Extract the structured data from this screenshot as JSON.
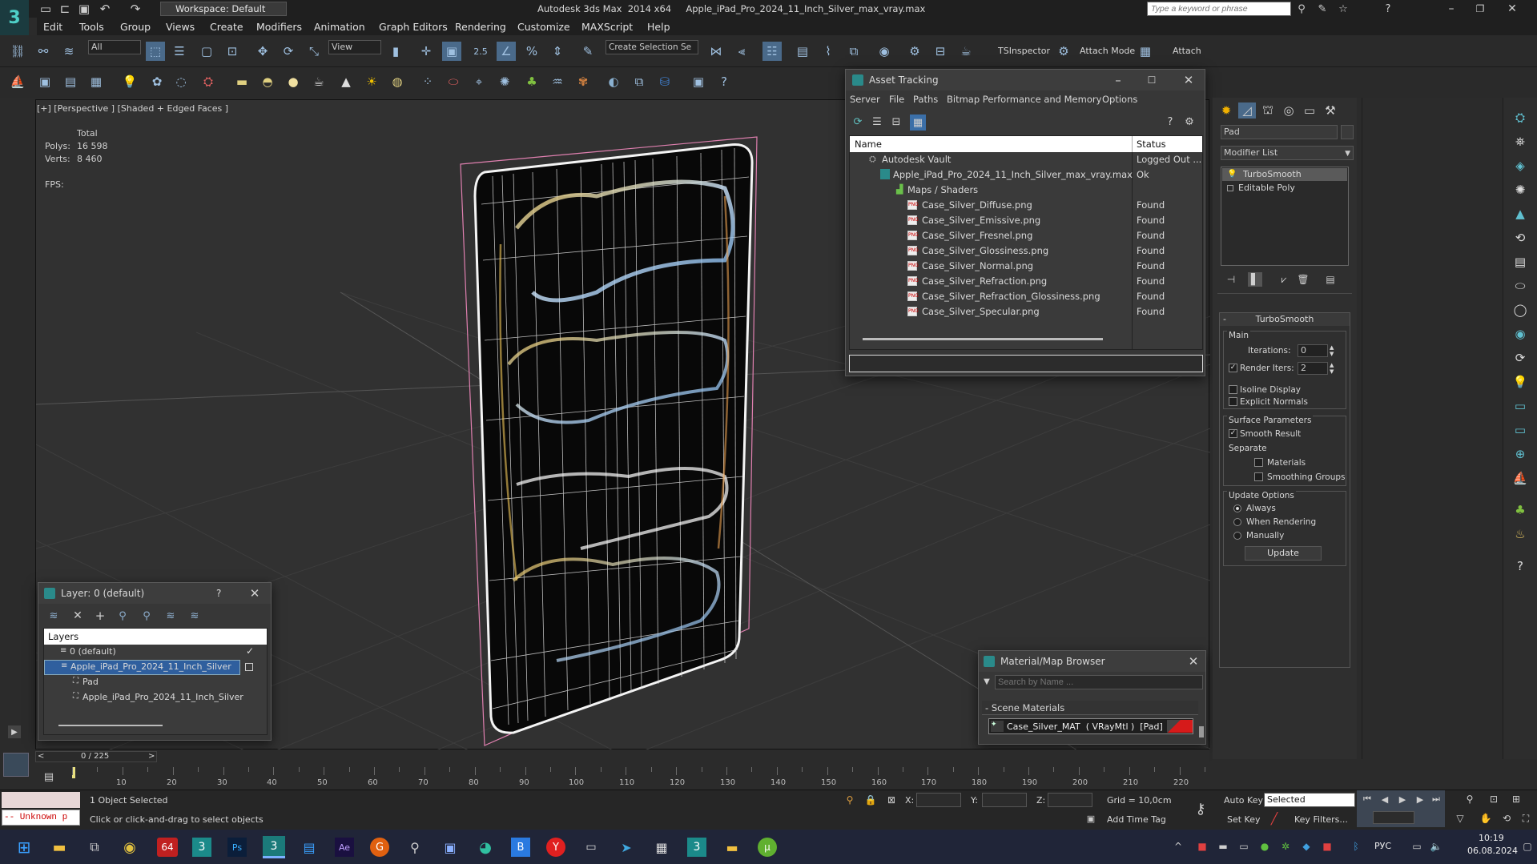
{
  "app": {
    "title": "Autodesk 3ds Max  2014 x64     Apple_iPad_Pro_2024_11_Inch_Silver_max_vray.max",
    "workspace_label": "Workspace: Default",
    "search_placeholder": "Type a keyword or phrase"
  },
  "menus": [
    "Edit",
    "Tools",
    "Group",
    "Views",
    "Create",
    "Modifiers",
    "Animation",
    "Graph Editors",
    "Rendering",
    "Customize",
    "MAXScript",
    "Help"
  ],
  "toolbar": {
    "selection_filter": "All",
    "ref_coord": "View",
    "snap_value": "2.5",
    "named_selection": "Create Selection Se",
    "tsinspector": "TSInspector",
    "attach_mode": "Attach Mode",
    "attach": "Attach"
  },
  "viewport": {
    "label": "[+] [Perspective ] [Shaded + Edged Faces ]",
    "stats_header": "Total",
    "polys_label": "Polys:",
    "polys_value": "16 598",
    "verts_label": "Verts:",
    "verts_value": "8 460",
    "fps_label": "FPS:"
  },
  "asset_tracking": {
    "title": "Asset Tracking",
    "menus": [
      "Server",
      "File",
      "Paths",
      "Bitmap Performance and Memory",
      "Options"
    ],
    "col_name": "Name",
    "col_status": "Status",
    "vault": {
      "name": "Autodesk Vault",
      "status": "Logged Out ..."
    },
    "file": {
      "name": "Apple_iPad_Pro_2024_11_Inch_Silver_max_vray.max",
      "status": "Ok"
    },
    "group": "Maps / Shaders",
    "maps": [
      {
        "name": "Case_Silver_Diffuse.png",
        "status": "Found"
      },
      {
        "name": "Case_Silver_Emissive.png",
        "status": "Found"
      },
      {
        "name": "Case_Silver_Fresnel.png",
        "status": "Found"
      },
      {
        "name": "Case_Silver_Glossiness.png",
        "status": "Found"
      },
      {
        "name": "Case_Silver_Normal.png",
        "status": "Found"
      },
      {
        "name": "Case_Silver_Refraction.png",
        "status": "Found"
      },
      {
        "name": "Case_Silver_Refraction_Glossiness.png",
        "status": "Found"
      },
      {
        "name": "Case_Silver_Specular.png",
        "status": "Found"
      }
    ]
  },
  "layer_dialog": {
    "title": "Layer: 0 (default)",
    "help": "?",
    "header": "Layers",
    "items": [
      "0 (default)",
      "Apple_iPad_Pro_2024_11_Inch_Silver",
      "Pad",
      "Apple_iPad_Pro_2024_11_Inch_Silver"
    ]
  },
  "material_browser": {
    "title": "Material/Map Browser",
    "search_placeholder": "Search by Name ...",
    "section": "Scene Materials",
    "material": "Case_Silver_MAT  ( VRayMtl )  [Pad]",
    "swatch_color": "#d61a1a"
  },
  "command_panel": {
    "object_name": "Pad",
    "modifier_list": "Modifier List",
    "stack": [
      "TurboSmooth",
      "Editable Poly"
    ],
    "rollout_title": "TurboSmooth",
    "main_label": "Main",
    "iterations_label": "Iterations:",
    "iterations_value": "0",
    "render_iters_label": "Render Iters:",
    "render_iters_value": "2",
    "isoline_label": "Isoline Display",
    "explicit_normals_label": "Explicit Normals",
    "surface_params_label": "Surface Parameters",
    "smooth_result_label": "Smooth Result",
    "separate_label": "Separate",
    "materials_label": "Materials",
    "smoothing_groups_label": "Smoothing Groups",
    "update_options_label": "Update Options",
    "always_label": "Always",
    "when_rendering_label": "When Rendering",
    "manually_label": "Manually",
    "update_button": "Update"
  },
  "timeline": {
    "frame": "0 / 225",
    "ticks": [
      "10",
      "20",
      "30",
      "40",
      "50",
      "60",
      "70",
      "80",
      "90",
      "100",
      "110",
      "120",
      "130",
      "140",
      "150",
      "160",
      "170",
      "180",
      "190",
      "200",
      "210",
      "220"
    ]
  },
  "status": {
    "script_listener": "-- Unknown p",
    "selection": "1 Object Selected",
    "prompt": "Click or click-and-drag to select objects",
    "x_label": "X:",
    "y_label": "Y:",
    "z_label": "Z:",
    "grid": "Grid = 10,0cm",
    "add_time_tag": "Add Time Tag",
    "auto_key": "Auto Key",
    "set_key": "Set Key",
    "selected": "Selected",
    "key_filters": "Key Filters..."
  },
  "taskbar": {
    "lang": "РУС",
    "time": "10:19",
    "date": "06.08.2024"
  }
}
